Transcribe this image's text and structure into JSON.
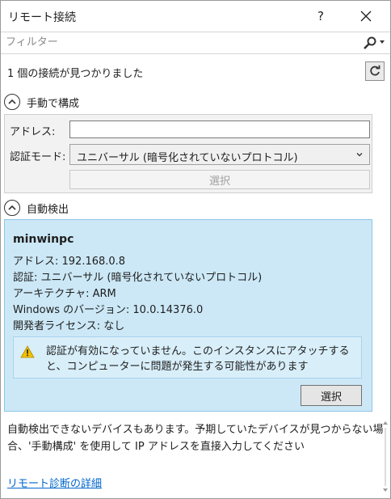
{
  "window": {
    "title": "リモート接続",
    "help_glyph": "?"
  },
  "filter": {
    "placeholder": "フィルター",
    "value": ""
  },
  "status": {
    "count_text": "1 個の接続が見つかりました"
  },
  "manual": {
    "header": "手動で構成",
    "address_label": "アドレス:",
    "address_value": "",
    "auth_label": "認証モード:",
    "auth_value": "ユニバーサル (暗号化されていないプロトコル)",
    "select_label": "選択"
  },
  "auto": {
    "header": "自動検出",
    "device": {
      "name": "minwinpc",
      "address": "アドレス: 192.168.0.8",
      "auth": "認証: ユニバーサル (暗号化されていないプロトコル)",
      "arch": "アーキテクチャ: ARM",
      "version": "Windows のバージョン: 10.0.14376.0",
      "license": "開発者ライセンス: なし"
    },
    "warning": "認証が有効になっていません。このインスタンスにアタッチすると、コンピューターに問題が発生する可能性があります",
    "select_label": "選択"
  },
  "footer": {
    "note": "自動検出できないデバイスもあります。予期していたデバイスが見つからない場合、'手動構成' を使用して IP アドレスを直接入力してください",
    "link": "リモート診断の詳細"
  },
  "colors": {
    "panel_bg": "#cce8f6",
    "link": "#0066cc",
    "warning": "#f0c000"
  },
  "icons": [
    "help-icon",
    "close-icon",
    "search-icon",
    "refresh-icon",
    "chevron-up-icon",
    "warning-icon",
    "chevron-down-icon"
  ]
}
